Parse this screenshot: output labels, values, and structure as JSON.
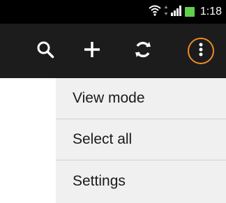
{
  "status_bar": {
    "time": "1:18",
    "icons": [
      "wifi-icon",
      "data-arrows-icon",
      "signal-icon",
      "battery-icon"
    ],
    "battery_color": "#5fd14a"
  },
  "toolbar": {
    "buttons": [
      "search-icon",
      "add-icon",
      "refresh-icon",
      "more-options-icon"
    ],
    "active_ring_color": "#f08a24"
  },
  "menu": {
    "items": [
      {
        "label": "View mode"
      },
      {
        "label": "Select all"
      },
      {
        "label": "Settings"
      }
    ]
  }
}
